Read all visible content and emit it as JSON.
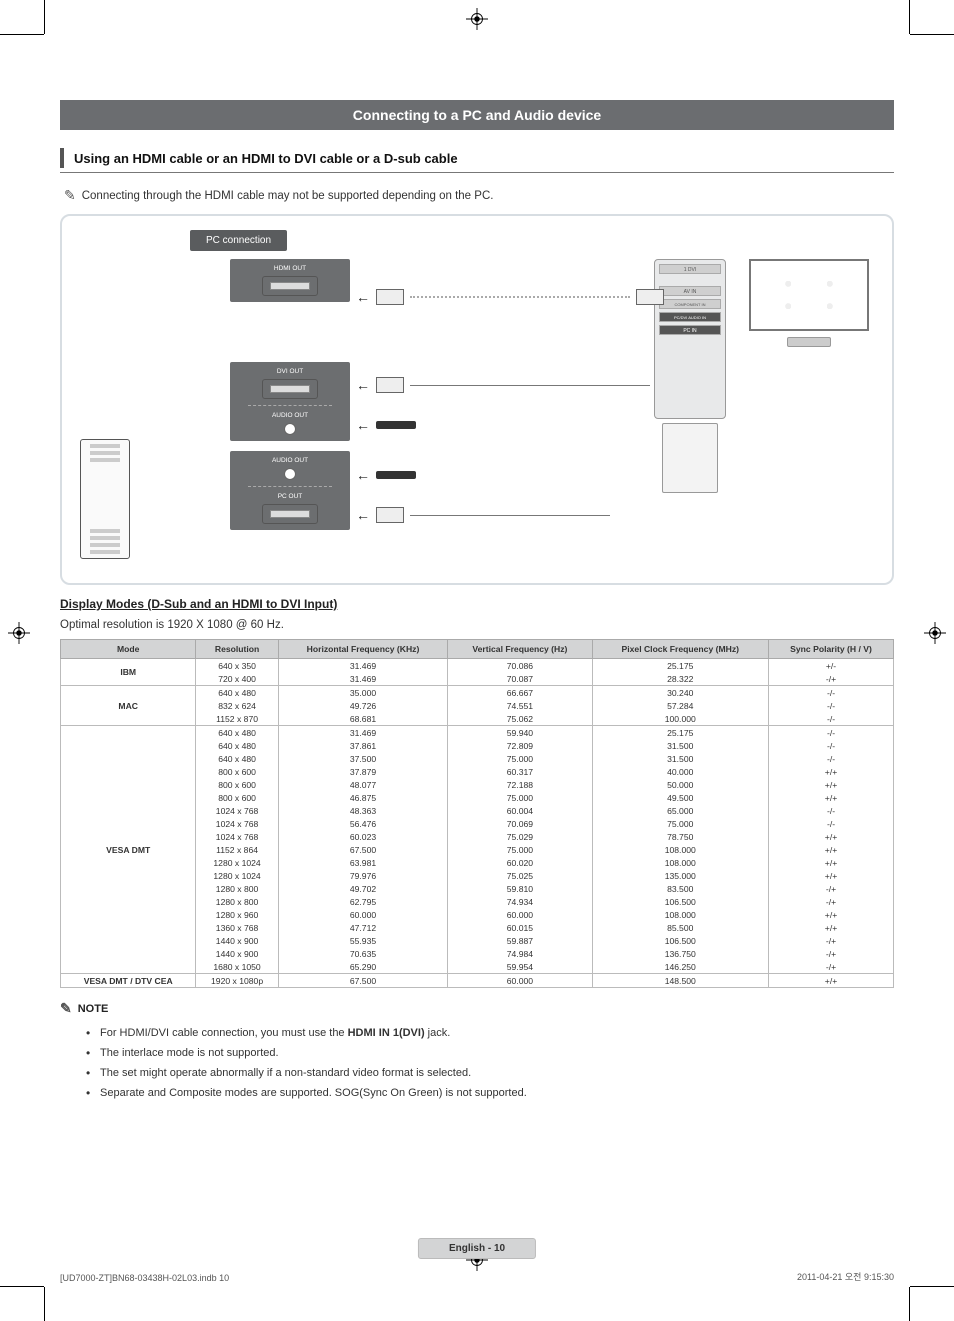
{
  "section_title": "Connecting to a PC and Audio device",
  "sub_heading": "Using an HDMI cable or an HDMI to DVI cable or a D-sub cable",
  "hand_note": "Connecting through the HDMI cable may not be supported depending on the PC.",
  "diagram": {
    "pc_connection_label": "PC connection",
    "hdmi_out": "HDMI OUT",
    "dvi_out": "DVI OUT",
    "audio_out_1": "AUDIO OUT",
    "audio_out_2": "AUDIO OUT",
    "pc_out": "PC OUT",
    "tv_ports": {
      "hdmi": "1 DVI",
      "av_in": "AV IN",
      "component_in": "COMPONENT IN",
      "pc_dvi_audio_in": "PC/DVI AUDIO IN",
      "pc_in": "PC IN"
    }
  },
  "display_modes_title": "Display Modes (D-Sub and an HDMI to DVI Input)",
  "optimal_resolution": "Optimal resolution is 1920 X 1080 @ 60 Hz.",
  "table": {
    "headers": [
      "Mode",
      "Resolution",
      "Horizontal Frequency (KHz)",
      "Vertical Frequency (Hz)",
      "Pixel Clock Frequency (MHz)",
      "Sync Polarity (H / V)"
    ],
    "groups": [
      {
        "mode": "IBM",
        "rows": [
          [
            "640 x 350",
            "31.469",
            "70.086",
            "25.175",
            "+/-"
          ],
          [
            "720 x 400",
            "31.469",
            "70.087",
            "28.322",
            "-/+"
          ]
        ]
      },
      {
        "mode": "MAC",
        "rows": [
          [
            "640 x 480",
            "35.000",
            "66.667",
            "30.240",
            "-/-"
          ],
          [
            "832 x 624",
            "49.726",
            "74.551",
            "57.284",
            "-/-"
          ],
          [
            "1152 x 870",
            "68.681",
            "75.062",
            "100.000",
            "-/-"
          ]
        ]
      },
      {
        "mode": "VESA DMT",
        "rows": [
          [
            "640 x 480",
            "31.469",
            "59.940",
            "25.175",
            "-/-"
          ],
          [
            "640 x 480",
            "37.861",
            "72.809",
            "31.500",
            "-/-"
          ],
          [
            "640 x 480",
            "37.500",
            "75.000",
            "31.500",
            "-/-"
          ],
          [
            "800 x 600",
            "37.879",
            "60.317",
            "40.000",
            "+/+"
          ],
          [
            "800 x 600",
            "48.077",
            "72.188",
            "50.000",
            "+/+"
          ],
          [
            "800 x 600",
            "46.875",
            "75.000",
            "49.500",
            "+/+"
          ],
          [
            "1024 x 768",
            "48.363",
            "60.004",
            "65.000",
            "-/-"
          ],
          [
            "1024 x 768",
            "56.476",
            "70.069",
            "75.000",
            "-/-"
          ],
          [
            "1024 x 768",
            "60.023",
            "75.029",
            "78.750",
            "+/+"
          ],
          [
            "1152 x 864",
            "67.500",
            "75.000",
            "108.000",
            "+/+"
          ],
          [
            "1280 x 1024",
            "63.981",
            "60.020",
            "108.000",
            "+/+"
          ],
          [
            "1280 x 1024",
            "79.976",
            "75.025",
            "135.000",
            "+/+"
          ],
          [
            "1280 x 800",
            "49.702",
            "59.810",
            "83.500",
            "-/+"
          ],
          [
            "1280 x 800",
            "62.795",
            "74.934",
            "106.500",
            "-/+"
          ],
          [
            "1280 x 960",
            "60.000",
            "60.000",
            "108.000",
            "+/+"
          ],
          [
            "1360 x 768",
            "47.712",
            "60.015",
            "85.500",
            "+/+"
          ],
          [
            "1440 x 900",
            "55.935",
            "59.887",
            "106.500",
            "-/+"
          ],
          [
            "1440 x 900",
            "70.635",
            "74.984",
            "136.750",
            "-/+"
          ],
          [
            "1680 x 1050",
            "65.290",
            "59.954",
            "146.250",
            "-/+"
          ]
        ]
      },
      {
        "mode": "VESA DMT / DTV CEA",
        "rows": [
          [
            "1920 x 1080p",
            "67.500",
            "60.000",
            "148.500",
            "+/+"
          ]
        ]
      }
    ]
  },
  "note_heading": "NOTE",
  "notes": [
    {
      "pre": "For HDMI/DVI cable connection, you must use the ",
      "bold": "HDMI IN 1(DVI)",
      "post": " jack."
    },
    {
      "pre": "The interlace mode is not supported.",
      "bold": "",
      "post": ""
    },
    {
      "pre": "The set might operate abnormally if a non-standard video format is selected.",
      "bold": "",
      "post": ""
    },
    {
      "pre": "Separate and Composite modes are supported. SOG(Sync On Green) is not supported.",
      "bold": "",
      "post": ""
    }
  ],
  "footer": {
    "lang_page": "English - 10",
    "left": "[UD7000-ZT]BN68-03438H-02L03.indb   10",
    "right": "2011-04-21   오전 9:15:30"
  }
}
